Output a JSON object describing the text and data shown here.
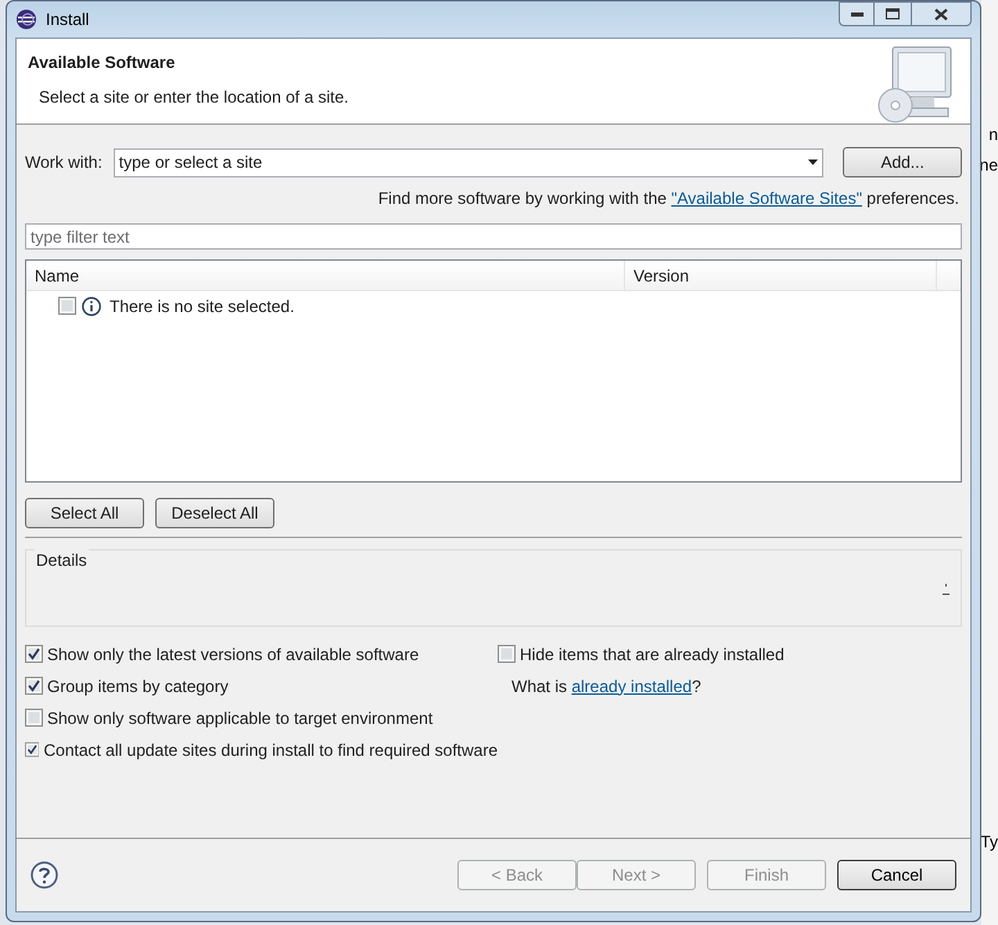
{
  "window": {
    "title": "Install"
  },
  "header": {
    "title": "Available Software",
    "subtitle": "Select a site or enter the location of a site."
  },
  "work_with": {
    "label": "Work with:",
    "value": "type or select a site",
    "button": "Add..."
  },
  "hint": {
    "before": "Find more software by working with the ",
    "link": "\"Available Software Sites\"",
    "after": " preferences."
  },
  "filter": {
    "placeholder": "type filter text"
  },
  "table": {
    "columns": [
      "Name",
      "Version"
    ],
    "rows": [
      {
        "name": "There is no site selected.",
        "checked": false
      }
    ]
  },
  "selection_buttons": [
    "Select All",
    "Deselect All"
  ],
  "details": {
    "label": "Details"
  },
  "options_left": [
    {
      "label": "Show only the latest versions of available software",
      "checked": true
    },
    {
      "label": "Group items by category",
      "checked": true
    },
    {
      "label": "Show only software applicable to target environment",
      "checked": false
    },
    {
      "label": "Contact all update sites during install to find required software",
      "checked": true
    }
  ],
  "options_right": [
    {
      "label": "Hide items that are already installed",
      "checked": false
    }
  ],
  "installed_hint": {
    "before": "What is ",
    "link": "already installed",
    "after": "?"
  },
  "buttons": [
    {
      "label": "< Back",
      "disabled": true
    },
    {
      "label": "Next >",
      "disabled": true
    },
    {
      "label": "Finish",
      "disabled": true
    },
    {
      "label": "Cancel",
      "disabled": false
    }
  ],
  "background_text": [
    "n",
    "ne",
    "Ty"
  ]
}
